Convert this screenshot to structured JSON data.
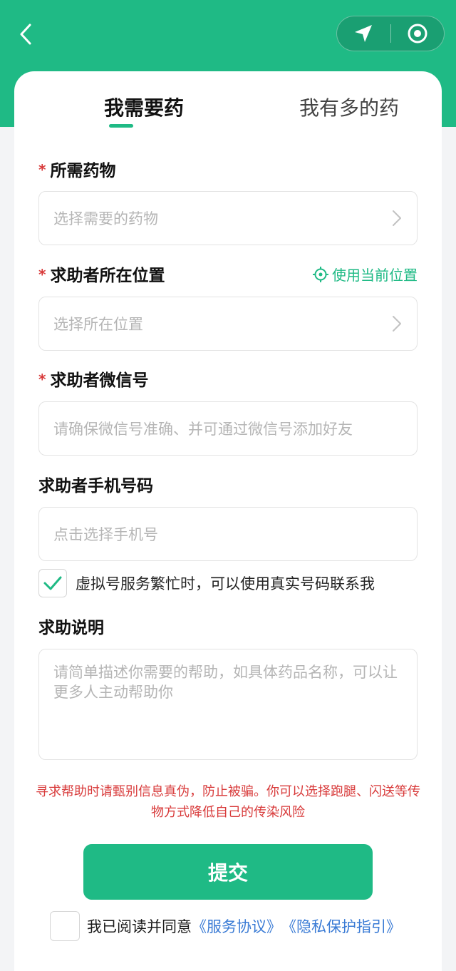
{
  "colors": {
    "brand": "#1fba85",
    "warning": "#d83a3a",
    "link": "#3a7bd5"
  },
  "header": {
    "back_icon": "chevron-left-icon",
    "capsule_icons": [
      "navigation-arrow-icon",
      "target-circle-icon"
    ]
  },
  "tabs": [
    {
      "label": "我需要药",
      "active": true
    },
    {
      "label": "我有多的药",
      "active": false
    }
  ],
  "form": {
    "medicine": {
      "required_mark": "*",
      "label": "所需药物",
      "placeholder": "选择需要的药物"
    },
    "location": {
      "required_mark": "*",
      "label": "求助者所在位置",
      "placeholder": "选择所在位置",
      "use_current_label": "使用当前位置"
    },
    "wechat": {
      "required_mark": "*",
      "label": "求助者微信号",
      "placeholder": "请确保微信号准确、并可通过微信号添加好友"
    },
    "phone": {
      "label": "求助者手机号码",
      "placeholder": "点击选择手机号"
    },
    "real_number_checkbox": {
      "checked": true,
      "label": "虚拟号服务繁忙时，可以使用真实号码联系我"
    },
    "description": {
      "label": "求助说明",
      "placeholder": "请简单描述你需要的帮助，如具体药品名称，可以让更多人主动帮助你"
    }
  },
  "warning_text": "寻求帮助时请甄别信息真伪，防止被骗。你可以选择跑腿、闪送等传物方式降低自己的传染风险",
  "submit_label": "提交",
  "agreement": {
    "checked": false,
    "prefix": "我已阅读并同意",
    "service_link": "《服务协议》",
    "privacy_link": "《隐私保护指引》"
  }
}
